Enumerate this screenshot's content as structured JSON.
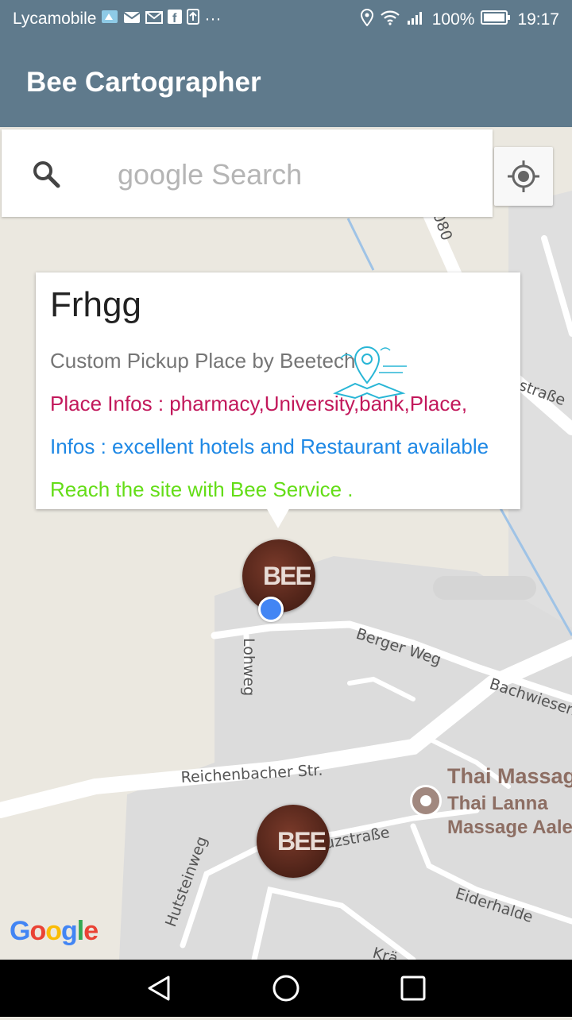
{
  "status": {
    "carrier": "Lycamobile",
    "notif_more": "···",
    "battery": "100%",
    "time": "19:17"
  },
  "app": {
    "title": "Bee Cartographer"
  },
  "search": {
    "placeholder": "google Search",
    "value": ""
  },
  "info": {
    "title": "Frhgg",
    "line1": "Custom Pickup Place  by Beetech",
    "line2": "Place Infos : pharmacy,University,bank,Place,",
    "line3": "Infos : excellent hotels and Restaurant available",
    "line4": "Reach the site with Bee Service ."
  },
  "map": {
    "streets": [
      "080",
      "straße",
      "Berger Weg",
      "Lohweg",
      "Bachwiesen",
      "Reichenbacher Str.",
      "uzstraße",
      "Hutsteinweg",
      "Eiderhalde",
      "Krä"
    ],
    "poi": {
      "name_line1": "Thai Massag",
      "name_line2": "Thai Lanna",
      "name_line3": "Massage Aalen"
    },
    "marker_label": "BEE",
    "attribution": "Google"
  },
  "colors": {
    "appbar": "#5f7a8c",
    "place_infos": "#c2185b",
    "infos": "#1e88e5",
    "reach": "#64dd17",
    "poi": "#8d6e63"
  }
}
